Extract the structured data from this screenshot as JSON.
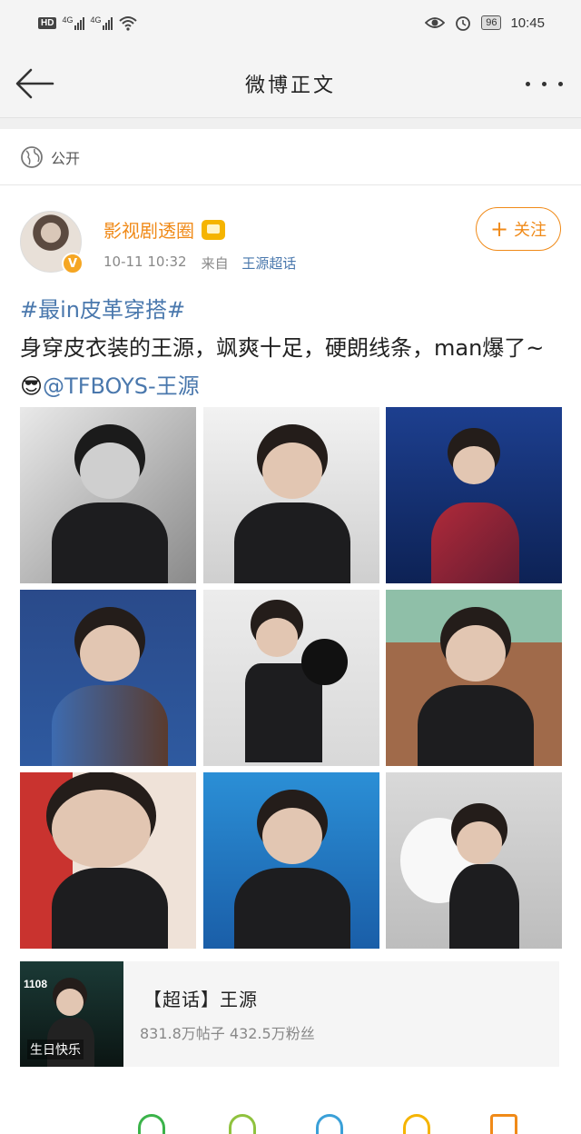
{
  "status_bar": {
    "hd": "HD",
    "sim1_network": "4G",
    "sim2_network": "4G",
    "battery": "96",
    "time": "10:45",
    "icons": [
      "eye-icon",
      "alarm-icon"
    ]
  },
  "nav": {
    "title": "微博正文",
    "back_icon": "arrow-left-icon",
    "more_icon": "more-dots-icon"
  },
  "visibility": {
    "icon": "globe-icon",
    "label": "公开"
  },
  "post": {
    "author": "影视剧透圈",
    "time": "10-11 10:32",
    "source_prefix": "来自",
    "source": "王源超话",
    "follow_label": "关注",
    "text": {
      "topic": "#最in皮革穿搭#",
      "body": "身穿皮衣装的王源，飒爽十足，硬朗线条，man爆了~😎",
      "mention": "@TFBOYS-王源"
    },
    "photos": [
      "photo-1",
      "photo-2",
      "photo-3",
      "photo-4",
      "photo-5",
      "photo-6",
      "photo-7",
      "photo-8",
      "photo-9"
    ]
  },
  "topic_card": {
    "title": "【超话】王源",
    "stats": "831.8万帖子 432.5万粉丝",
    "thumb_number": "1108",
    "thumb_caption": "生日快乐"
  },
  "colors": {
    "accent_orange": "#f08a18",
    "link_blue": "#4a78ad"
  }
}
